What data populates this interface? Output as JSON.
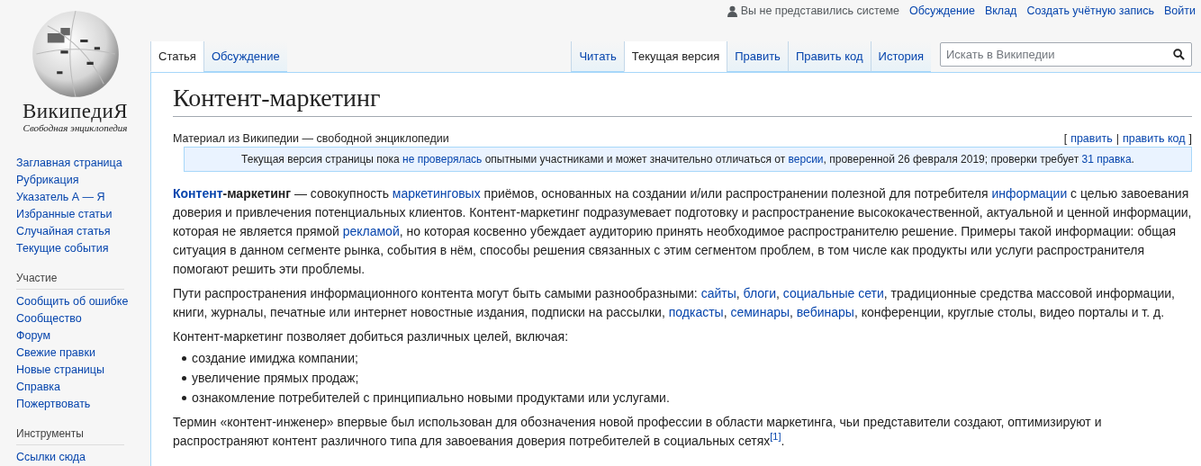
{
  "logo": {
    "wordmark": "ВикипедиЯ",
    "tagline": "Свободная энциклопедия"
  },
  "personal_bar": {
    "status": "Вы не представились системе",
    "links": [
      "Обсуждение",
      "Вклад",
      "Создать учётную запись",
      "Войти"
    ]
  },
  "namespace_tabs": [
    {
      "label": "Статья",
      "selected": true
    },
    {
      "label": "Обсуждение",
      "selected": false
    }
  ],
  "view_tabs": [
    {
      "label": "Читать",
      "selected": false
    },
    {
      "label": "Текущая версия",
      "selected": true
    },
    {
      "label": "Править",
      "selected": false
    },
    {
      "label": "Править код",
      "selected": false
    },
    {
      "label": "История",
      "selected": false
    }
  ],
  "search": {
    "placeholder": "Искать в Википедии"
  },
  "sidebar": {
    "sections": [
      {
        "items": [
          "Заглавная страница",
          "Рубрикация",
          "Указатель А — Я",
          "Избранные статьи",
          "Случайная статья",
          "Текущие события"
        ]
      },
      {
        "heading": "Участие",
        "items": [
          "Сообщить об ошибке",
          "Сообщество",
          "Форум",
          "Свежие правки",
          "Новые страницы",
          "Справка",
          "Пожертвовать"
        ]
      },
      {
        "heading": "Инструменты",
        "items": [
          "Ссылки сюда"
        ]
      }
    ]
  },
  "article": {
    "title": "Контент-маркетинг",
    "subtitle": "Материал из Википедии — свободной энциклопедии",
    "edit_links": {
      "open": "[",
      "links": [
        "править",
        "править код"
      ],
      "separator": "|",
      "close": "]"
    },
    "notice": [
      {
        "text": "Текущая версия страницы пока "
      },
      {
        "text": "не проверялась",
        "link": true
      },
      {
        "text": " опытными участниками и может значительно отличаться от "
      },
      {
        "text": "версии",
        "link": true
      },
      {
        "text": ", проверенной 26 февраля 2019; проверки требует "
      },
      {
        "text": "31 правка",
        "link": true
      },
      {
        "text": "."
      }
    ],
    "blocks": [
      {
        "kind": "paragraph",
        "runs": [
          {
            "text": "Контент",
            "link": true,
            "bold": true
          },
          {
            "text": "-маркетинг",
            "bold": true
          },
          {
            "text": " — совокупность "
          },
          {
            "text": "маркетинговых",
            "link": true
          },
          {
            "text": " приёмов, основанных на создании и/или распространении полезной для потребителя "
          },
          {
            "text": "информации",
            "link": true
          },
          {
            "text": " с целью завоевания доверия и привлечения потенциальных клиентов. Контент-маркетинг подразумевает подготовку и распространение высококачественной, актуальной и ценной информации, которая не является прямой "
          },
          {
            "text": "рекламой",
            "link": true
          },
          {
            "text": ", но которая косвенно убеждает аудиторию принять необходимое распространителю решение. Примеры такой информации: общая ситуация в данном сегменте рынка, события в нём, способы решения связанных с этим сегментом проблем, в том числе как продукты или услуги распространителя помогают решить эти проблемы."
          }
        ]
      },
      {
        "kind": "paragraph",
        "runs": [
          {
            "text": "Пути распространения информационного контента могут быть самыми разнообразными: "
          },
          {
            "text": "сайты",
            "link": true
          },
          {
            "text": ", "
          },
          {
            "text": "блоги",
            "link": true
          },
          {
            "text": ", "
          },
          {
            "text": "социальные сети",
            "link": true
          },
          {
            "text": ", традиционные средства массовой информации, книги, журналы, печатные или интернет новостные издания, подписки на рассылки, "
          },
          {
            "text": "подкасты",
            "link": true
          },
          {
            "text": ", "
          },
          {
            "text": "семинары",
            "link": true
          },
          {
            "text": ", "
          },
          {
            "text": "вебинары",
            "link": true
          },
          {
            "text": ", конференции, круглые столы, видео порталы и т. д."
          }
        ]
      },
      {
        "kind": "paragraph",
        "runs": [
          {
            "text": "Контент-маркетинг позволяет добиться различных целей, включая:"
          }
        ]
      },
      {
        "kind": "list",
        "items": [
          "создание имиджа компании;",
          "увеличение прямых продаж;",
          "ознакомление потребителей с принципиально новыми продуктами или услугами."
        ]
      },
      {
        "kind": "paragraph",
        "runs": [
          {
            "text": "Термин «контент-инженер» впервые был использован для обозначения новой профессии в области маркетинга, чьи представители создают, оптимизируют и распространяют контент различного типа для завоевания доверия потребителей в социальных сетях"
          },
          {
            "text": "[1]",
            "link": true,
            "sup": true
          },
          {
            "text": "."
          }
        ]
      }
    ]
  }
}
